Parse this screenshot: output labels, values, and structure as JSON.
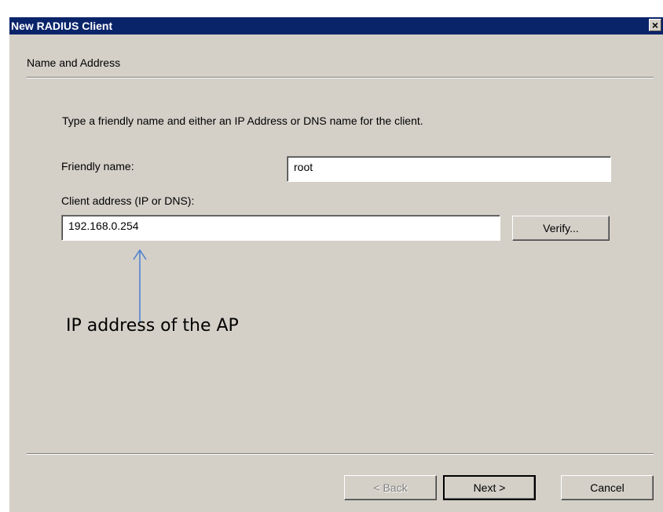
{
  "window": {
    "title": "New RADIUS Client",
    "close_glyph": "×"
  },
  "page": {
    "section_title": "Name and Address",
    "instruction": "Type a friendly name and either an IP Address or DNS name for the client."
  },
  "form": {
    "friendly_name_label": "Friendly name:",
    "friendly_name_value": "root",
    "client_address_label": "Client address (IP or DNS):",
    "client_address_value": "192.168.0.254",
    "verify_label": "Verify..."
  },
  "buttons": {
    "back": "< Back",
    "next": "Next >",
    "cancel": "Cancel"
  },
  "annotation": {
    "text": "IP address of the AP",
    "arrow_color": "#4a7fd0"
  },
  "icons": {
    "close": "close-icon",
    "arrow": "up-arrow-icon"
  }
}
